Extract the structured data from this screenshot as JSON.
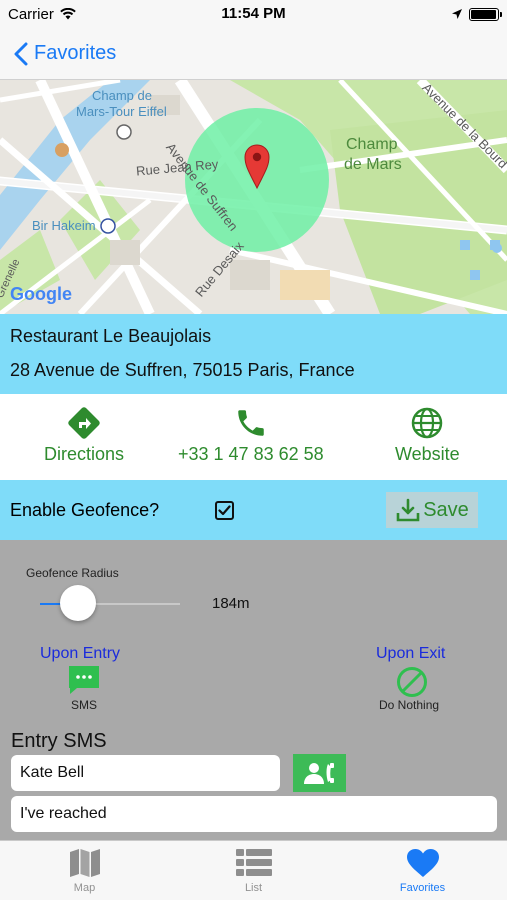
{
  "status_bar": {
    "carrier": "Carrier",
    "time": "11:54 PM",
    "battery_level": 0.95
  },
  "nav": {
    "back_label": "Favorites"
  },
  "map": {
    "labels": {
      "champ_de_mars_tour_eiffel_1": "Champ de",
      "champ_de_mars_tour_eiffel_2": "Mars-Tour Eiffel",
      "rue_jean_rey": "Rue Jean Rey",
      "avenue_de_suffren": "Avenue de Suffren",
      "champ_de_mars_1": "Champ",
      "champ_de_mars_2": "de Mars",
      "bir_hakeim": "Bir Hakeim",
      "rue_desaix": "Rue Desaix",
      "avenue_la_bourdonnais": "Avenue de la Bourd",
      "grenelle": "Grenelle",
      "google": "Google"
    }
  },
  "place": {
    "name": "Restaurant Le Beaujolais",
    "address": "28 Avenue de Suffren, 75015 Paris, France"
  },
  "actions": {
    "directions_label": "Directions",
    "phone_label": "+33 1 47 83 62 58",
    "website_label": "Website"
  },
  "geofence": {
    "enable_label": "Enable Geofence?",
    "enabled": true,
    "save_label": "Save",
    "radius_label": "Geofence Radius",
    "radius_value": "184m",
    "radius_fraction": 0.27,
    "entry_title": "Upon Entry",
    "entry_action_label": "SMS",
    "exit_title": "Upon Exit",
    "exit_action_label": "Do Nothing",
    "entry_sms_title": "Entry SMS",
    "recipient_value": "Kate Bell",
    "message_value": "I've reached"
  },
  "tabs": [
    {
      "label": "Map",
      "icon": "map-icon",
      "active": false
    },
    {
      "label": "List",
      "icon": "list-icon",
      "active": false
    },
    {
      "label": "Favorites",
      "icon": "heart-icon",
      "active": true
    }
  ],
  "colors": {
    "accent": "#1a7af5",
    "action_green": "#2e8b2e",
    "info_bg": "#7fdcf9",
    "panel_bg": "#a9a9a9",
    "geofence_circle": "#6ef0a6",
    "pin": "#e53935"
  }
}
